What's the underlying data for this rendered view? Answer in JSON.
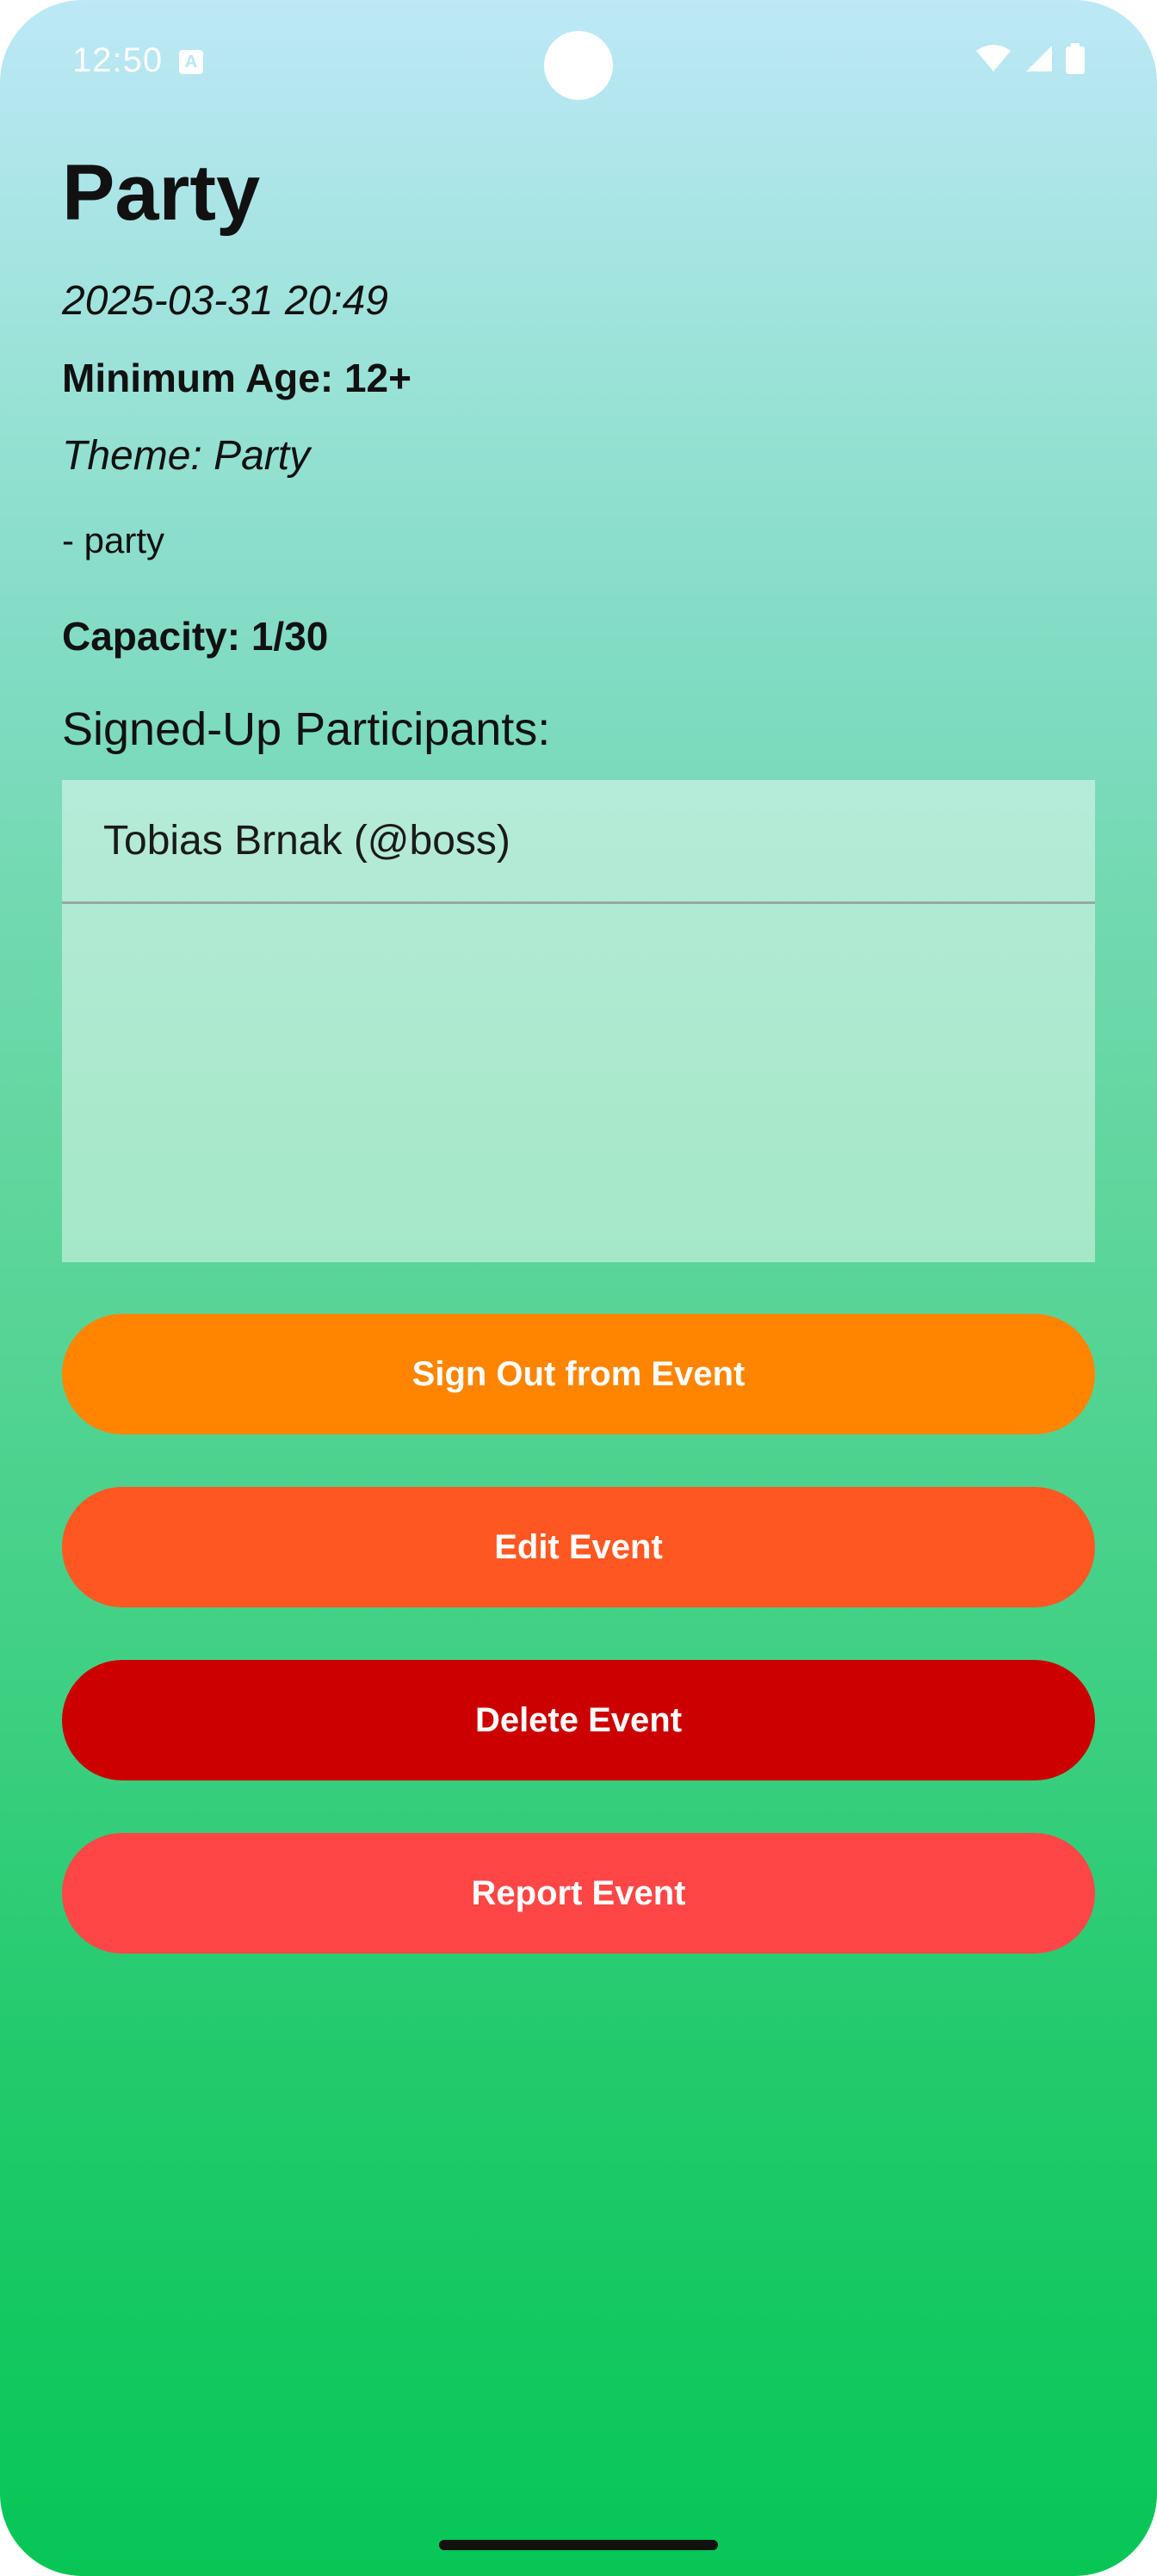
{
  "status_bar": {
    "time": "12:50",
    "notification_icon": "A",
    "icons": [
      "wifi-icon",
      "signal-icon",
      "battery-icon"
    ]
  },
  "event": {
    "title": "Party",
    "datetime": "2025-03-31 20:49",
    "min_age": "Minimum Age: 12+",
    "theme": "Theme: Party",
    "description": "- party",
    "capacity": "Capacity: 1/30"
  },
  "participants": {
    "heading": "Signed-Up Participants:",
    "items": [
      "Tobias Brnak (@boss)"
    ]
  },
  "buttons": {
    "sign_out": "Sign Out from Event",
    "edit": "Edit Event",
    "delete": "Delete Event",
    "report": "Report Event"
  },
  "colors": {
    "sign_out": "#ff8500",
    "edit": "#ff5722",
    "delete": "#cc0000",
    "report": "#ff4646",
    "gradient_top": "#bde8f7",
    "gradient_bottom": "#07c656"
  }
}
